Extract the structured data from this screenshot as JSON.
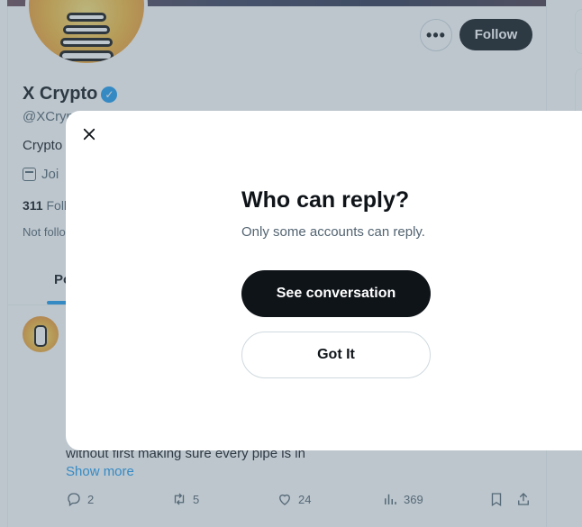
{
  "profile": {
    "name": "X Crypto",
    "handle": "@XCryp",
    "bio": "Crypto",
    "joined": "Joi",
    "following_count": "311",
    "following_label": "Follo",
    "not_followed": "Not follo",
    "more_label": "•••",
    "follow_label": "Follow",
    "verified_glyph": "✓"
  },
  "tabs": {
    "posts": "Po"
  },
  "tweet": {
    "text_fragment": "without first making sure every pipe is in",
    "show_more": "Show more",
    "replies": "2",
    "reposts": "5",
    "likes": "24",
    "views": "369"
  },
  "icons": {
    "close": "close-icon",
    "calendar": "calendar-icon",
    "verified": "verified-badge-icon",
    "reply": "reply-icon",
    "repost": "repost-icon",
    "like": "heart-icon",
    "views": "views-icon",
    "bookmark": "bookmark-icon",
    "share": "share-icon"
  },
  "modal": {
    "title": "Who can reply?",
    "subtitle": "Only some accounts can reply.",
    "primary_button": "See conversation",
    "secondary_button": "Got It"
  },
  "colors": {
    "accent": "#1d9bf0",
    "primary_text": "#0f1419",
    "secondary_text": "#536471",
    "overlay": "rgba(91,112,131,0.40)"
  }
}
